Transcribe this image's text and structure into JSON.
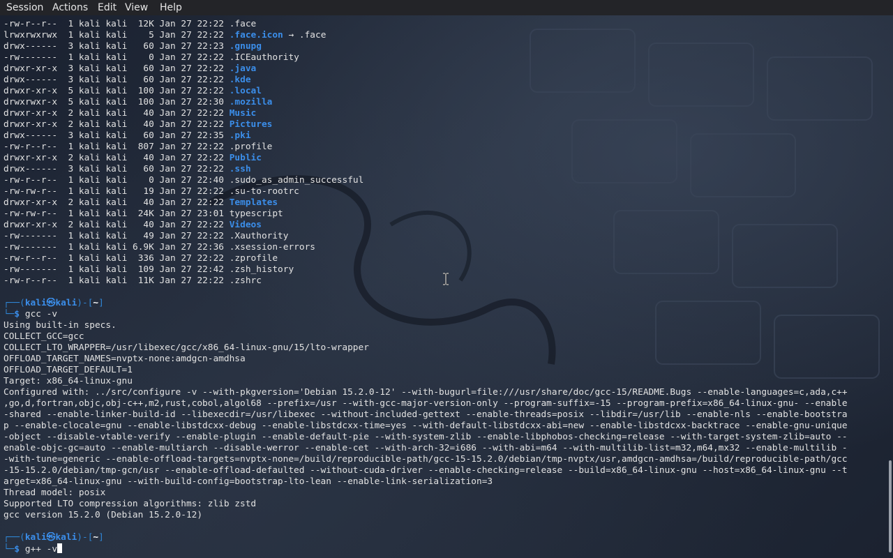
{
  "menubar": {
    "items": [
      "Session",
      "Actions",
      "Edit",
      "View",
      "Help"
    ]
  },
  "listing": [
    {
      "perms": "-rw-r--r--",
      "links": "1",
      "owner": "kali",
      "group": "kali",
      "size": " 12K",
      "date": "Jan 27 22:22",
      "name": ".face",
      "kind": "file"
    },
    {
      "perms": "lrwxrwxrwx",
      "links": "1",
      "owner": "kali",
      "group": "kali",
      "size": "   5",
      "date": "Jan 27 22:22",
      "name": ".face.icon",
      "kind": "link",
      "target": ".face"
    },
    {
      "perms": "drwx------",
      "links": "3",
      "owner": "kali",
      "group": "kali",
      "size": "  60",
      "date": "Jan 27 22:23",
      "name": ".gnupg",
      "kind": "dir"
    },
    {
      "perms": "-rw-------",
      "links": "1",
      "owner": "kali",
      "group": "kali",
      "size": "   0",
      "date": "Jan 27 22:22",
      "name": ".ICEauthority",
      "kind": "file"
    },
    {
      "perms": "drwxr-xr-x",
      "links": "3",
      "owner": "kali",
      "group": "kali",
      "size": "  60",
      "date": "Jan 27 22:22",
      "name": ".java",
      "kind": "dir"
    },
    {
      "perms": "drwx------",
      "links": "3",
      "owner": "kali",
      "group": "kali",
      "size": "  60",
      "date": "Jan 27 22:22",
      "name": ".kde",
      "kind": "dir"
    },
    {
      "perms": "drwxr-xr-x",
      "links": "5",
      "owner": "kali",
      "group": "kali",
      "size": " 100",
      "date": "Jan 27 22:22",
      "name": ".local",
      "kind": "dir"
    },
    {
      "perms": "drwxrwxr-x",
      "links": "5",
      "owner": "kali",
      "group": "kali",
      "size": " 100",
      "date": "Jan 27 22:30",
      "name": ".mozilla",
      "kind": "dir"
    },
    {
      "perms": "drwxr-xr-x",
      "links": "2",
      "owner": "kali",
      "group": "kali",
      "size": "  40",
      "date": "Jan 27 22:22",
      "name": "Music",
      "kind": "dir"
    },
    {
      "perms": "drwxr-xr-x",
      "links": "2",
      "owner": "kali",
      "group": "kali",
      "size": "  40",
      "date": "Jan 27 22:22",
      "name": "Pictures",
      "kind": "dir"
    },
    {
      "perms": "drwx------",
      "links": "3",
      "owner": "kali",
      "group": "kali",
      "size": "  60",
      "date": "Jan 27 22:35",
      "name": ".pki",
      "kind": "dir"
    },
    {
      "perms": "-rw-r--r--",
      "links": "1",
      "owner": "kali",
      "group": "kali",
      "size": " 807",
      "date": "Jan 27 22:22",
      "name": ".profile",
      "kind": "file"
    },
    {
      "perms": "drwxr-xr-x",
      "links": "2",
      "owner": "kali",
      "group": "kali",
      "size": "  40",
      "date": "Jan 27 22:22",
      "name": "Public",
      "kind": "dir"
    },
    {
      "perms": "drwx------",
      "links": "3",
      "owner": "kali",
      "group": "kali",
      "size": "  60",
      "date": "Jan 27 22:22",
      "name": ".ssh",
      "kind": "dir"
    },
    {
      "perms": "-rw-r--r--",
      "links": "1",
      "owner": "kali",
      "group": "kali",
      "size": "   0",
      "date": "Jan 27 22:40",
      "name": ".sudo_as_admin_successful",
      "kind": "file"
    },
    {
      "perms": "-rw-rw-r--",
      "links": "1",
      "owner": "kali",
      "group": "kali",
      "size": "  19",
      "date": "Jan 27 22:22",
      "name": ".su-to-rootrc",
      "kind": "file"
    },
    {
      "perms": "drwxr-xr-x",
      "links": "2",
      "owner": "kali",
      "group": "kali",
      "size": "  40",
      "date": "Jan 27 22:22",
      "name": "Templates",
      "kind": "dir"
    },
    {
      "perms": "-rw-rw-r--",
      "links": "1",
      "owner": "kali",
      "group": "kali",
      "size": " 24K",
      "date": "Jan 27 23:01",
      "name": "typescript",
      "kind": "file"
    },
    {
      "perms": "drwxr-xr-x",
      "links": "2",
      "owner": "kali",
      "group": "kali",
      "size": "  40",
      "date": "Jan 27 22:22",
      "name": "Videos",
      "kind": "dir"
    },
    {
      "perms": "-rw-------",
      "links": "1",
      "owner": "kali",
      "group": "kali",
      "size": "  49",
      "date": "Jan 27 22:22",
      "name": ".Xauthority",
      "kind": "file"
    },
    {
      "perms": "-rw-------",
      "links": "1",
      "owner": "kali",
      "group": "kali",
      "size": "6.9K",
      "date": "Jan 27 22:36",
      "name": ".xsession-errors",
      "kind": "file"
    },
    {
      "perms": "-rw-r--r--",
      "links": "1",
      "owner": "kali",
      "group": "kali",
      "size": " 336",
      "date": "Jan 27 22:22",
      "name": ".zprofile",
      "kind": "file"
    },
    {
      "perms": "-rw-------",
      "links": "1",
      "owner": "kali",
      "group": "kali",
      "size": " 109",
      "date": "Jan 27 22:42",
      "name": ".zsh_history",
      "kind": "file"
    },
    {
      "perms": "-rw-r--r--",
      "links": "1",
      "owner": "kali",
      "group": "kali",
      "size": " 11K",
      "date": "Jan 27 22:22",
      "name": ".zshrc",
      "kind": "file"
    }
  ],
  "prompt": {
    "top_open": "┌──(",
    "user": "kali",
    "at": "㉿",
    "host": "kali",
    "mid": ")-[",
    "dir": "~",
    "top_close": "]",
    "bottom": "└─",
    "dollar": "$"
  },
  "commands": {
    "first": "gcc -v",
    "second": "g++ -v"
  },
  "gcc_output": [
    "Using built-in specs.",
    "COLLECT_GCC=gcc",
    "COLLECT_LTO_WRAPPER=/usr/libexec/gcc/x86_64-linux-gnu/15/lto-wrapper",
    "OFFLOAD_TARGET_NAMES=nvptx-none:amdgcn-amdhsa",
    "OFFLOAD_TARGET_DEFAULT=1",
    "Target: x86_64-linux-gnu",
    "Configured with: ../src/configure -v --with-pkgversion='Debian 15.2.0-12' --with-bugurl=file:///usr/share/doc/gcc-15/README.Bugs --enable-languages=c,ada,c++",
    ",go,d,fortran,objc,obj-c++,m2,rust,cobol,algol68 --prefix=/usr --with-gcc-major-version-only --program-suffix=-15 --program-prefix=x86_64-linux-gnu- --enable",
    "-shared --enable-linker-build-id --libexecdir=/usr/libexec --without-included-gettext --enable-threads=posix --libdir=/usr/lib --enable-nls --enable-bootstra",
    "p --enable-clocale=gnu --enable-libstdcxx-debug --enable-libstdcxx-time=yes --with-default-libstdcxx-abi=new --enable-libstdcxx-backtrace --enable-gnu-unique",
    "-object --disable-vtable-verify --enable-plugin --enable-default-pie --with-system-zlib --enable-libphobos-checking=release --with-target-system-zlib=auto --",
    "enable-objc-gc=auto --enable-multiarch --disable-werror --enable-cet --with-arch-32=i686 --with-abi=m64 --with-multilib-list=m32,m64,mx32 --enable-multilib -",
    "-with-tune=generic --enable-offload-targets=nvptx-none=/build/reproducible-path/gcc-15-15.2.0/debian/tmp-nvptx/usr,amdgcn-amdhsa=/build/reproducible-path/gcc",
    "-15-15.2.0/debian/tmp-gcn/usr --enable-offload-defaulted --without-cuda-driver --enable-checking=release --build=x86_64-linux-gnu --host=x86_64-linux-gnu --t",
    "arget=x86_64-linux-gnu --with-build-config=bootstrap-lto-lean --enable-link-serialization=3",
    "Thread model: posix",
    "Supported LTO compression algorithms: zlib zstd",
    "gcc version 15.2.0 (Debian 15.2.0-12)"
  ]
}
